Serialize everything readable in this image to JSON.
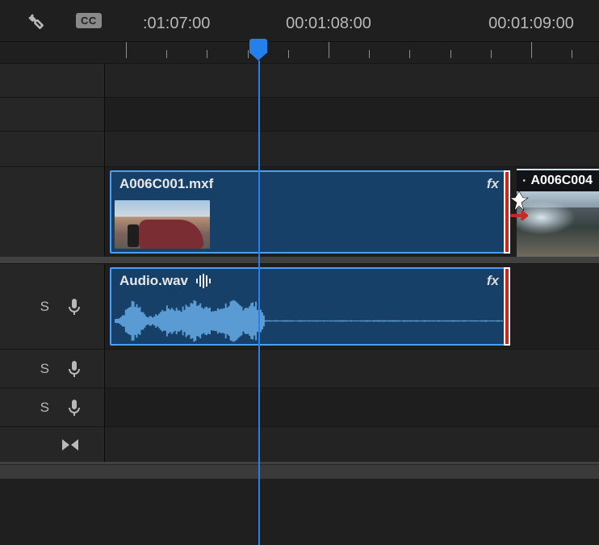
{
  "ruler": {
    "labels": [
      ":01:07:00",
      "00:01:08:00",
      "00:01:09:00"
    ]
  },
  "clips": {
    "video1": {
      "name": "A006C001.mxf",
      "fx": "fx"
    },
    "video2": {
      "name": "A006C004"
    },
    "audio1": {
      "name": "Audio.wav",
      "fx": "fx"
    }
  },
  "trackHeads": {
    "solo": "S"
  },
  "toolbar": {
    "cc": "CC"
  }
}
